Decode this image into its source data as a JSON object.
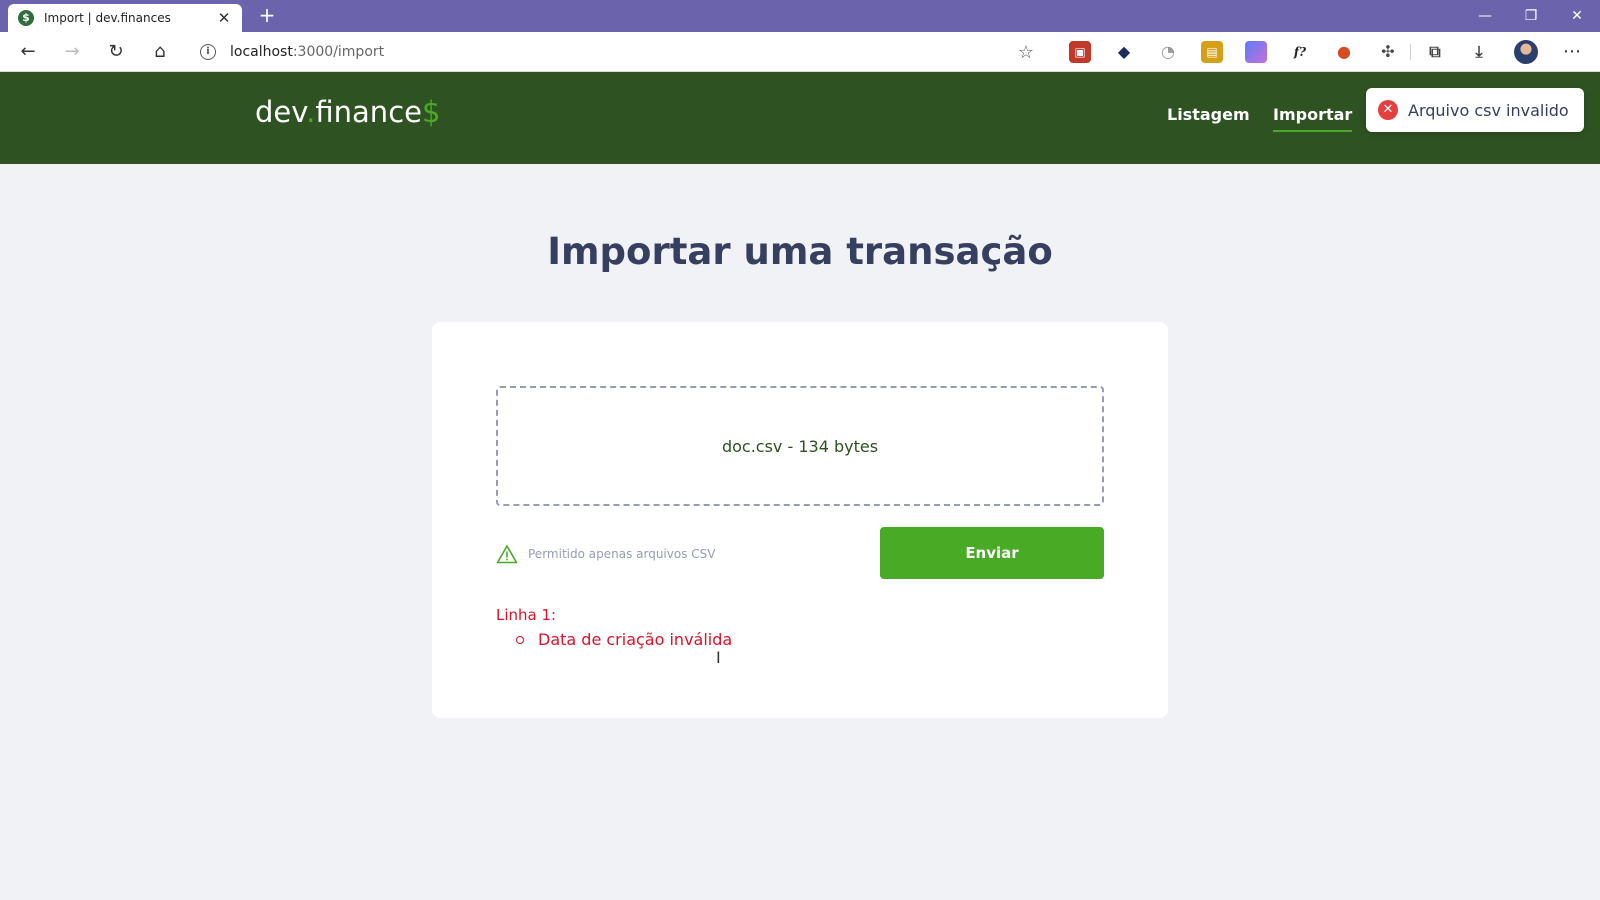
{
  "browser": {
    "tab_title": "Import | dev.finances",
    "tab_favicon": "$",
    "url_host": "localhost",
    "url_path": ":3000/import",
    "new_tab_icon": "+",
    "extensions_icons": [
      "ext-red-icon",
      "ext-diamond-icon",
      "ext-clock-icon",
      "ext-card-icon",
      "ext-gradient-icon",
      "ext-formula-icon",
      "ext-lock-icon",
      "puzzle-icon",
      "collections-icon",
      "download-icon"
    ]
  },
  "header": {
    "logo_main": "dev",
    "logo_dot": ".",
    "logo_rest": "finance",
    "logo_dollar": "$",
    "nav": [
      {
        "label": "Listagem",
        "active": false
      },
      {
        "label": "Importar",
        "active": true
      }
    ]
  },
  "toast": {
    "message": "Arquivo csv invalido",
    "type": "error",
    "icon": "✕"
  },
  "main": {
    "title": "Importar uma transação",
    "file_info": "doc.csv - 134 bytes",
    "hint": "Permitido apenas arquivos CSV",
    "submit_label": "Enviar",
    "errors": {
      "line_label": "Linha 1:",
      "items": [
        "Data de criação inválida"
      ]
    }
  },
  "colors": {
    "header_bg": "#2f5223",
    "accent": "#49aa26",
    "error": "#d9132c",
    "title": "#363f5f",
    "page_bg": "#f0f2f5"
  }
}
